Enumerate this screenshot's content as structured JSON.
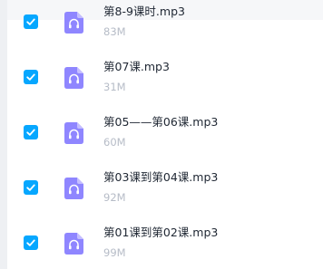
{
  "accent_color": "#06a7ff",
  "icon_color": "#8f86ff",
  "files": [
    {
      "name": "第8-9课时.mp3",
      "size": "83M",
      "checked": true,
      "icon": "audio-file-icon"
    },
    {
      "name": "第07课.mp3",
      "size": "31M",
      "checked": true,
      "icon": "audio-file-icon"
    },
    {
      "name": "第05——第06课.mp3",
      "size": "60M",
      "checked": true,
      "icon": "audio-file-icon"
    },
    {
      "name": "第03课到第04课.mp3",
      "size": "92M",
      "checked": true,
      "icon": "audio-file-icon"
    },
    {
      "name": "第01课到第02课.mp3",
      "size": "99M",
      "checked": true,
      "icon": "audio-file-icon"
    }
  ]
}
